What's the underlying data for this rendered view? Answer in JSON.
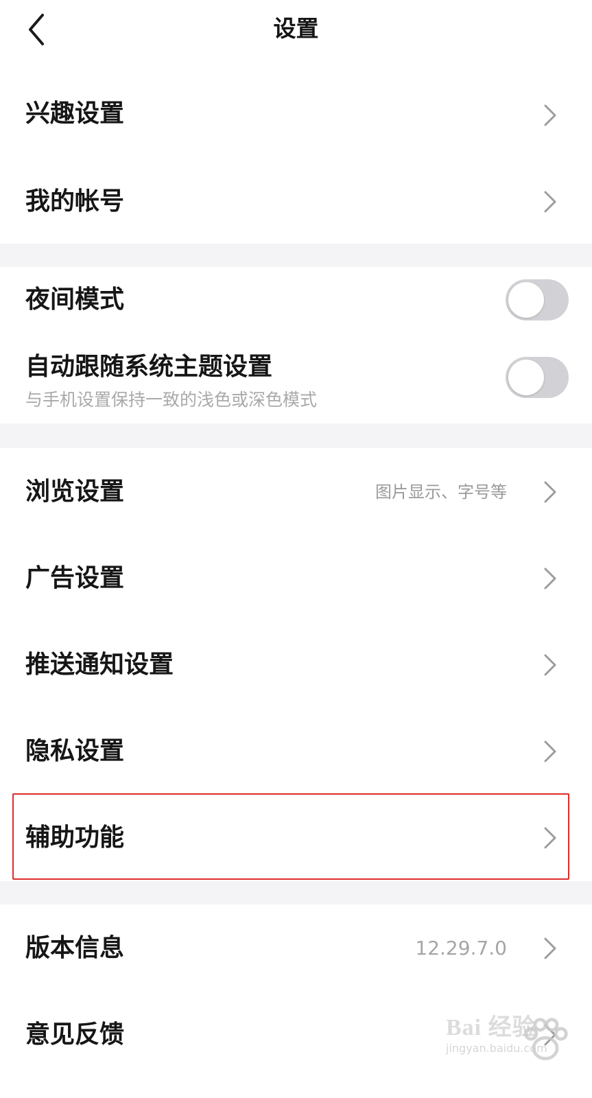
{
  "header": {
    "title": "设置",
    "back_icon": "chevron-left-icon"
  },
  "section1": {
    "items": [
      {
        "label": "兴趣设置"
      },
      {
        "label": "我的帐号"
      }
    ]
  },
  "section2": {
    "night_mode": {
      "label": "夜间模式",
      "on": false
    },
    "follow_system": {
      "label": "自动跟随系统主题设置",
      "sub": "与手机设置保持一致的浅色或深色模式",
      "on": false
    }
  },
  "section3": {
    "items": [
      {
        "label": "浏览设置",
        "value": "图片显示、字号等"
      },
      {
        "label": "广告设置"
      },
      {
        "label": "推送通知设置"
      },
      {
        "label": "隐私设置"
      },
      {
        "label": "辅助功能"
      }
    ]
  },
  "section4": {
    "items": [
      {
        "label": "版本信息",
        "value": "12.29.7.0"
      },
      {
        "label": "意见反馈"
      }
    ]
  },
  "watermark": {
    "brand": "Bai  经验",
    "url": "jingyan.baidu.com"
  },
  "colors": {
    "background": "#ffffff",
    "divider": "#f4f4f6",
    "toggle_off": "#d2d2d6",
    "highlight": "#e02b2b",
    "secondary_text": "#9a9a9a"
  }
}
